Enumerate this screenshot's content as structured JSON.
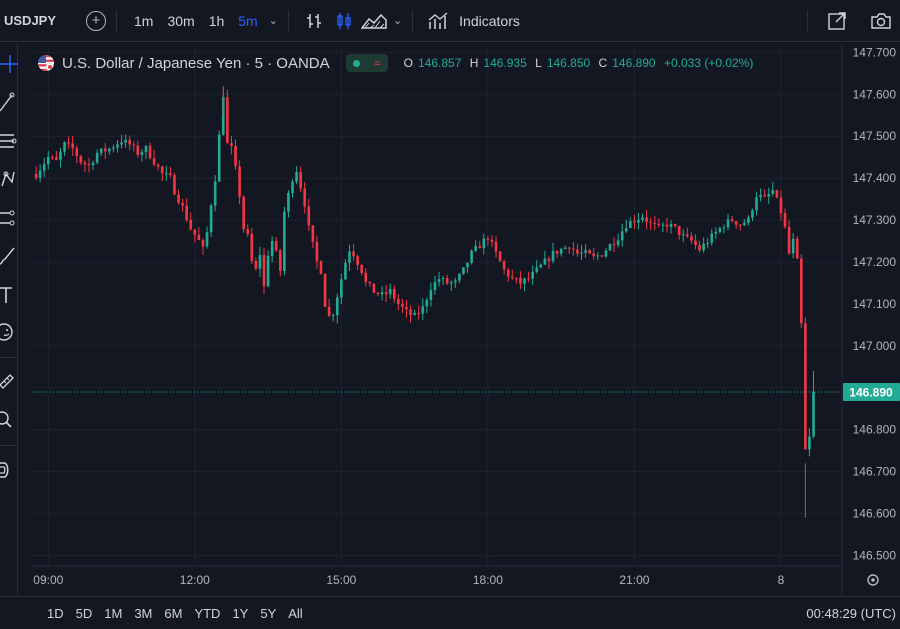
{
  "toolbar": {
    "symbol": "USDJPY",
    "intervals": [
      "1m",
      "30m",
      "1h",
      "5m"
    ],
    "active_interval": "5m",
    "indicators_label": "Indicators",
    "icons": [
      "add-symbol-icon",
      "bar-style-icon",
      "candles-icon",
      "area-icon",
      "chevron-down-icon",
      "indicators-icon",
      "fullscreen-icon",
      "camera-icon"
    ]
  },
  "left_tools": [
    "crosshair-icon",
    "trendline-icon",
    "fib-icon",
    "pattern-icon",
    "forecast-icon",
    "brush-icon",
    "text-icon",
    "emoji-icon",
    "ruler-icon",
    "zoom-icon",
    "magnet-icon"
  ],
  "legend": {
    "title": "U.S. Dollar / Japanese Yen · 5 · OANDA",
    "open_key": "O",
    "open": "146.857",
    "high_key": "H",
    "high": "146.935",
    "low_key": "L",
    "low": "146.850",
    "close_key": "C",
    "close": "146.890",
    "change": "+0.033 (+0.02%)"
  },
  "colors": {
    "up": "#22ab94",
    "down": "#f23645",
    "background": "#131722",
    "grid": "#1e222d",
    "text": "#b2b5be",
    "accent": "#2962ff"
  },
  "chart_data": {
    "type": "candlestick",
    "interval": "5m",
    "y_ticks": [
      "147.700",
      "147.600",
      "147.500",
      "147.400",
      "147.300",
      "147.200",
      "147.100",
      "147.000",
      "146.900",
      "146.800",
      "146.700",
      "146.600",
      "146.500"
    ],
    "ylim": [
      146.475,
      147.72
    ],
    "x_ticks": [
      "09:00",
      "12:00",
      "15:00",
      "18:00",
      "21:00",
      "8"
    ],
    "x_tick_positions": [
      0,
      36,
      72,
      108,
      144,
      180
    ],
    "x_range": [
      -4,
      195
    ],
    "last_price": "146.890",
    "last_price_value": 146.89,
    "close_path": [
      [
        -3,
        147.41
      ],
      [
        0,
        147.45
      ],
      [
        2,
        147.44
      ],
      [
        4,
        147.48
      ],
      [
        6,
        147.47
      ],
      [
        8,
        147.44
      ],
      [
        10,
        147.43
      ],
      [
        12,
        147.46
      ],
      [
        15,
        147.47
      ],
      [
        18,
        147.49
      ],
      [
        20,
        147.48
      ],
      [
        22,
        147.46
      ],
      [
        24,
        147.47
      ],
      [
        26,
        147.44
      ],
      [
        28,
        147.41
      ],
      [
        30,
        147.4
      ],
      [
        31,
        147.37
      ],
      [
        32,
        147.35
      ],
      [
        33,
        147.33
      ],
      [
        35,
        147.28
      ],
      [
        37,
        147.25
      ],
      [
        38,
        147.23
      ],
      [
        39,
        147.27
      ],
      [
        40,
        147.34
      ],
      [
        41,
        147.4
      ],
      [
        42,
        147.5
      ],
      [
        43,
        147.6
      ],
      [
        44,
        147.48
      ],
      [
        45,
        147.47
      ],
      [
        46,
        147.42
      ],
      [
        47,
        147.36
      ],
      [
        48,
        147.28
      ],
      [
        49,
        147.26
      ],
      [
        50,
        147.2
      ],
      [
        51,
        147.18
      ],
      [
        52,
        147.22
      ],
      [
        53,
        147.14
      ],
      [
        54,
        147.22
      ],
      [
        55,
        147.25
      ],
      [
        56,
        147.22
      ],
      [
        57,
        147.18
      ],
      [
        58,
        147.32
      ],
      [
        59,
        147.36
      ],
      [
        60,
        147.4
      ],
      [
        61,
        147.42
      ],
      [
        62,
        147.38
      ],
      [
        63,
        147.34
      ],
      [
        64,
        147.28
      ],
      [
        65,
        147.24
      ],
      [
        66,
        147.2
      ],
      [
        67,
        147.18
      ],
      [
        68,
        147.1
      ],
      [
        69,
        147.07
      ],
      [
        70,
        147.08
      ],
      [
        71,
        147.12
      ],
      [
        72,
        147.16
      ],
      [
        73,
        147.2
      ],
      [
        74,
        147.23
      ],
      [
        75,
        147.22
      ],
      [
        76,
        147.2
      ],
      [
        77,
        147.18
      ],
      [
        78,
        147.15
      ],
      [
        80,
        147.13
      ],
      [
        82,
        147.12
      ],
      [
        84,
        147.13
      ],
      [
        86,
        147.1
      ],
      [
        88,
        147.08
      ],
      [
        90,
        147.07
      ],
      [
        92,
        147.09
      ],
      [
        94,
        147.14
      ],
      [
        96,
        147.16
      ],
      [
        98,
        147.15
      ],
      [
        100,
        147.15
      ],
      [
        102,
        147.18
      ],
      [
        104,
        147.22
      ],
      [
        106,
        147.24
      ],
      [
        108,
        147.26
      ],
      [
        110,
        147.22
      ],
      [
        112,
        147.18
      ],
      [
        114,
        147.16
      ],
      [
        116,
        147.15
      ],
      [
        118,
        147.16
      ],
      [
        120,
        147.18
      ],
      [
        122,
        147.2
      ],
      [
        124,
        147.22
      ],
      [
        126,
        147.23
      ],
      [
        128,
        147.24
      ],
      [
        130,
        147.22
      ],
      [
        132,
        147.22
      ],
      [
        134,
        147.21
      ],
      [
        136,
        147.22
      ],
      [
        138,
        147.24
      ],
      [
        140,
        147.26
      ],
      [
        142,
        147.29
      ],
      [
        144,
        147.3
      ],
      [
        146,
        147.31
      ],
      [
        148,
        147.29
      ],
      [
        150,
        147.28
      ],
      [
        152,
        147.29
      ],
      [
        154,
        147.28
      ],
      [
        156,
        147.26
      ],
      [
        158,
        147.25
      ],
      [
        160,
        147.23
      ],
      [
        162,
        147.25
      ],
      [
        164,
        147.27
      ],
      [
        166,
        147.29
      ],
      [
        168,
        147.3
      ],
      [
        170,
        147.29
      ],
      [
        172,
        147.3
      ],
      [
        174,
        147.36
      ],
      [
        176,
        147.35
      ],
      [
        178,
        147.37
      ],
      [
        180,
        147.32
      ],
      [
        181,
        147.28
      ],
      [
        182,
        147.22
      ],
      [
        183,
        147.25
      ],
      [
        184,
        147.2
      ],
      [
        185,
        147.05
      ],
      [
        186,
        146.75
      ],
      [
        187,
        146.78
      ],
      [
        188,
        146.89
      ]
    ]
  },
  "bottom": {
    "ranges": [
      "1D",
      "5D",
      "1M",
      "3M",
      "6M",
      "YTD",
      "1Y",
      "5Y",
      "All"
    ],
    "clock": "00:48:29 (UTC)"
  }
}
